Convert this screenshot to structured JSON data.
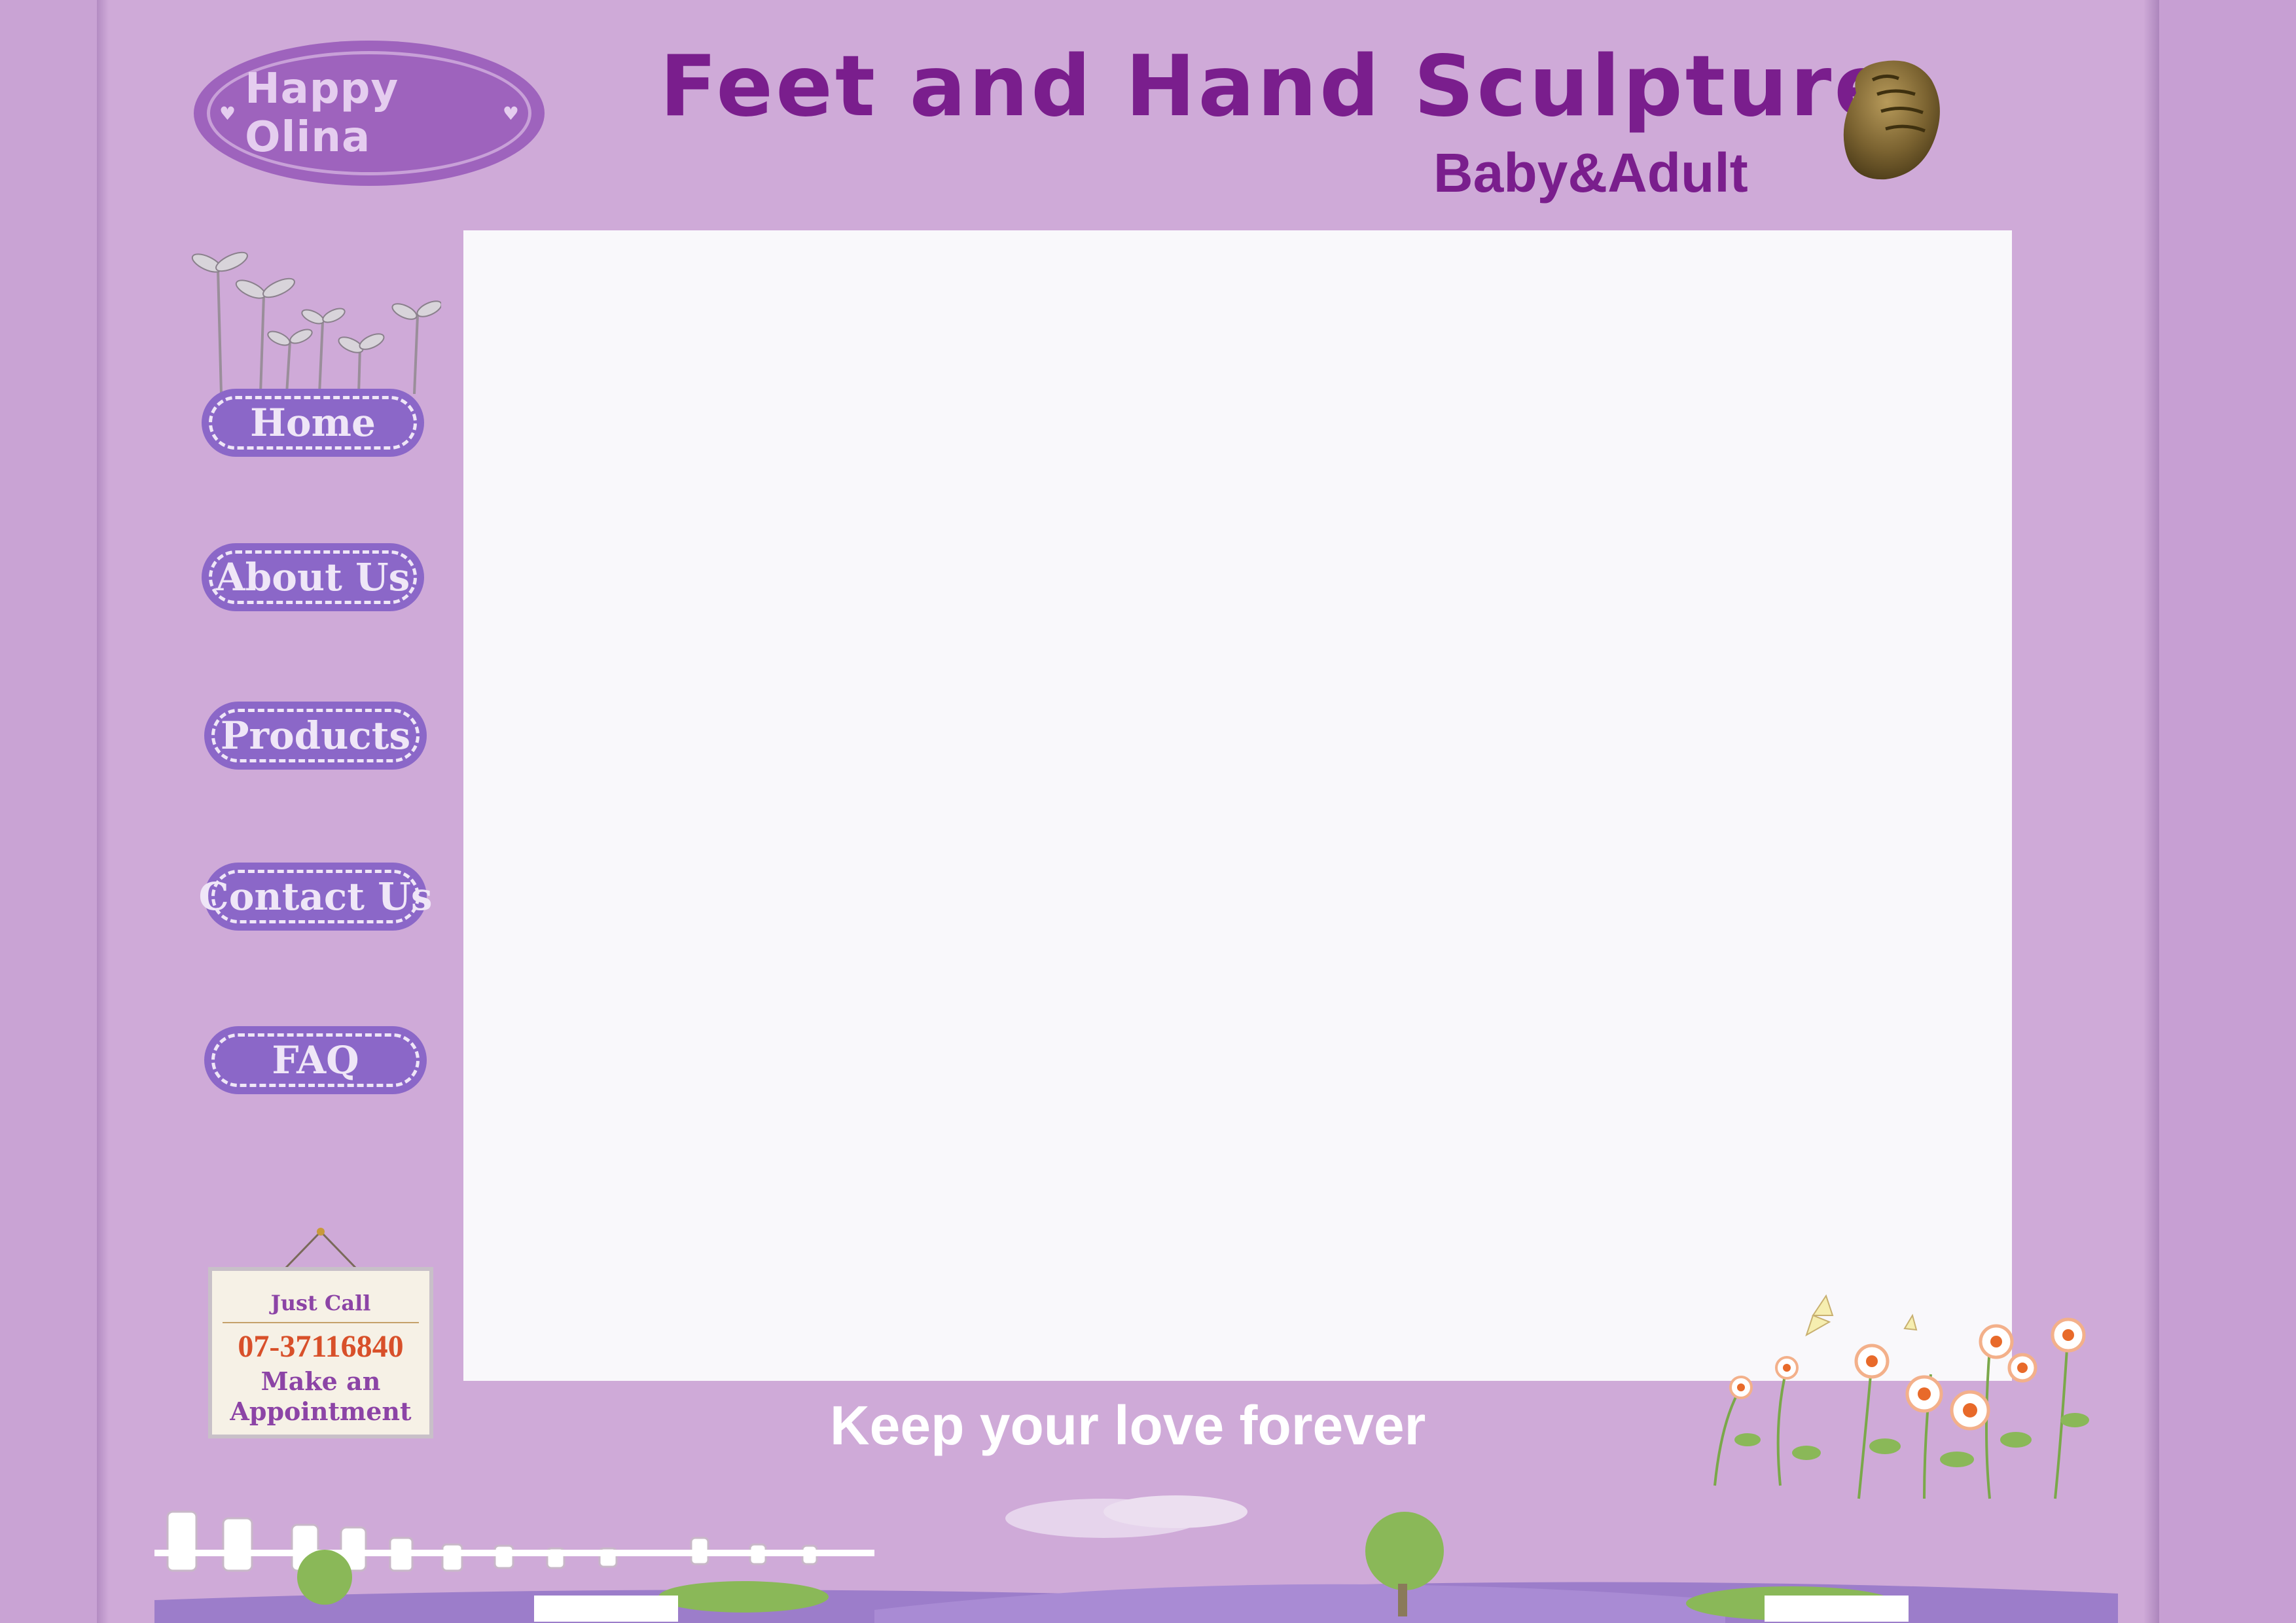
{
  "header": {
    "logo_text": "Happy Olina",
    "title": "Feet and Hand Sculpture",
    "subtitle": "Baby&Adult"
  },
  "nav": {
    "items": [
      {
        "label": "Home"
      },
      {
        "label": "About Us"
      },
      {
        "label": "Products"
      },
      {
        "label": "Contact Us"
      },
      {
        "label": "FAQ"
      }
    ]
  },
  "sign": {
    "heading": "Just Call",
    "phone": "07-37116840",
    "line1": "Make an",
    "line2": "Appointment"
  },
  "footer": {
    "tagline": "Keep your love forever"
  },
  "colors": {
    "background": "#cfaad8",
    "accent_purple": "#7a1e8d",
    "button": "#8b67c8",
    "panel": "#f9f8fb",
    "phone": "#d8502a"
  },
  "icons": {
    "logo_hearts": "heart-icon",
    "header_image": "bronze-fist-icon"
  }
}
